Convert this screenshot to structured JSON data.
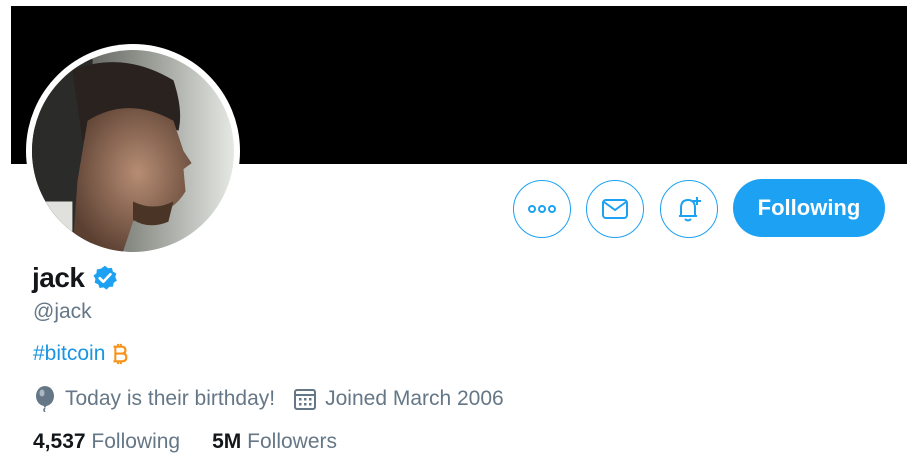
{
  "profile": {
    "name": "jack",
    "handle": "@jack",
    "bio_hashtag": "#bitcoin",
    "birthday_text": "Today is their birthday!",
    "joined_text": "Joined March 2006",
    "following_count": "4,537",
    "following_label": "Following",
    "followers_count": "5M",
    "followers_label": "Followers"
  },
  "actions": {
    "follow_label": "Following"
  },
  "icons": {
    "more": "more-dots-icon",
    "message": "envelope-icon",
    "notify": "bell-plus-icon",
    "verified": "verified-badge-icon",
    "bitcoin": "bitcoin-emoji-icon",
    "birthday": "balloon-icon",
    "calendar": "calendar-icon"
  },
  "colors": {
    "accent": "#1da1f2",
    "hashtag": "#1b95e0",
    "muted": "#657786",
    "bitcoin": "#f7931a"
  }
}
